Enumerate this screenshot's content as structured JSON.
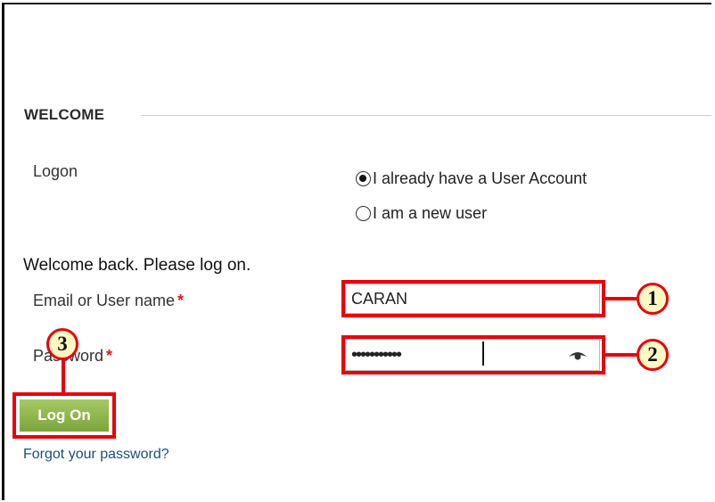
{
  "welcome": {
    "heading": "WELCOME",
    "logon_label": "Logon",
    "radio_existing": "I already have a User Account",
    "radio_new": "I am a new user",
    "message": "Welcome back. Please log on."
  },
  "form": {
    "email_label": "Email or User name",
    "password_label": "Password",
    "required_marker": "*",
    "email_value": "CARAN",
    "password_mask": "•••••••••••",
    "logon_button": "Log On",
    "forgot_link": "Forgot your password?"
  },
  "callouts": {
    "email_number": "1",
    "password_number": "2",
    "button_number": "3"
  },
  "colors": {
    "callout_red": "#e8000b",
    "badge_fill": "#fff9c4",
    "button_green": "#8db44c",
    "required_red": "#e8141e",
    "link_blue": "#1e4d7a"
  },
  "icons": {
    "password_toggle": "eye-icon"
  }
}
